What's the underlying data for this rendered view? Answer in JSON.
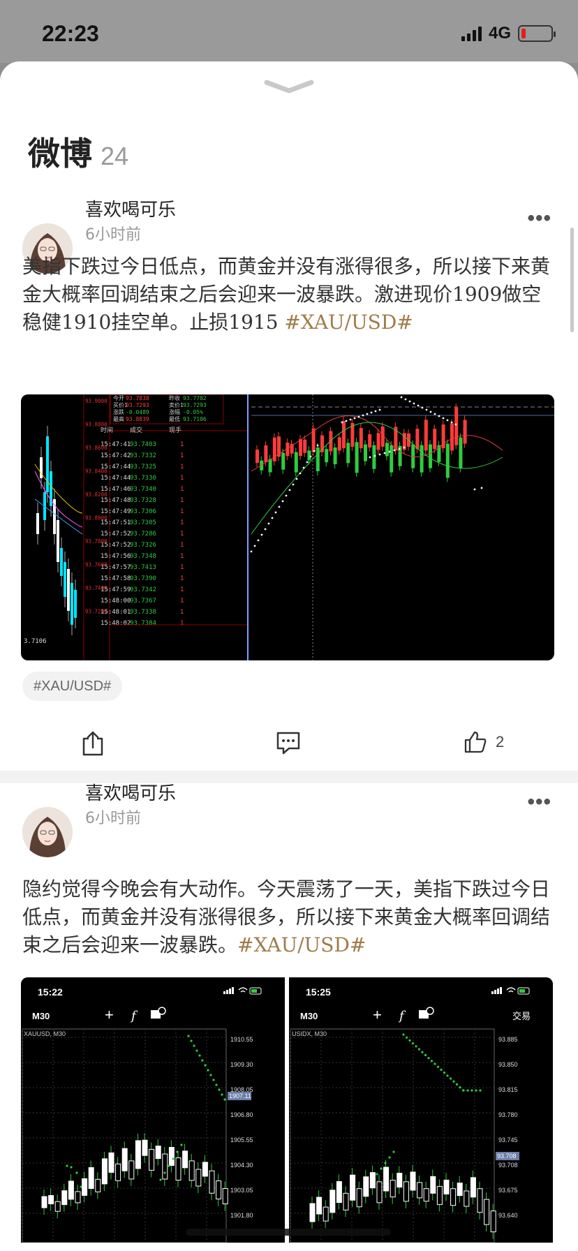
{
  "status_bar": {
    "time": "22:23",
    "network": "4G"
  },
  "header": {
    "title": "微博",
    "count": "24"
  },
  "posts": [
    {
      "author": "喜欢喝可乐",
      "time": "6小时前",
      "text": "美指下跌过今日低点，而黄金并没有涨得很多，所以接下来黄金大概率回调结束之后会迎来一波暴跌。激进现价1909做空稳健1910挂空单。止损1915 ",
      "hashtag": "#XAU/USD#",
      "topic_chip": "#XAU/USD#",
      "likes": "2",
      "image": {
        "left_price_label": "3.7106",
        "quote_rows": [
          {
            "k1": "今开",
            "v1": "93.7838",
            "k2": "昨收",
            "v2": "93.7782"
          },
          {
            "k1": "买价1",
            "v1": "93.7293",
            "k2": "卖价1",
            "v2": "93.7293"
          },
          {
            "k1": "涨跌",
            "v1": "-0.0489",
            "k2": "涨幅",
            "v2": "-0.05%"
          },
          {
            "k1": "最高",
            "v1": "93.8839",
            "k2": "最低",
            "v2": "93.7106"
          }
        ],
        "axis_prices": [
          "93.9000",
          "93.8800",
          "93.8600",
          "93.8400",
          "93.8200",
          "93.8000",
          "93.7800",
          "93.7600",
          "93.7400",
          "93.7200"
        ],
        "ticks_header": {
          "time": "时间",
          "price": "成交",
          "volume": "现手"
        },
        "ticks": [
          {
            "time": "15:47:41",
            "price": "93.7403",
            "vol": "1"
          },
          {
            "time": "15:47:42",
            "price": "93.7332",
            "vol": "1"
          },
          {
            "time": "15:47:44",
            "price": "93.7325",
            "vol": "1"
          },
          {
            "time": "15:47:44",
            "price": "93.7330",
            "vol": "1"
          },
          {
            "time": "15:47:46",
            "price": "93.7340",
            "vol": "1"
          },
          {
            "time": "15:47:48",
            "price": "93.7328",
            "vol": "1"
          },
          {
            "time": "15:47:49",
            "price": "93.7306",
            "vol": "1"
          },
          {
            "time": "15:47:51",
            "price": "93.7305",
            "vol": "1"
          },
          {
            "time": "15:47:52",
            "price": "93.7286",
            "vol": "1"
          },
          {
            "time": "15:47:52",
            "price": "93.7326",
            "vol": "1"
          },
          {
            "time": "15:47:56",
            "price": "93.7348",
            "vol": "1"
          },
          {
            "time": "15:47:57",
            "price": "93.7413",
            "vol": "1"
          },
          {
            "time": "15:47:58",
            "price": "93.7390",
            "vol": "1"
          },
          {
            "time": "15:47:59",
            "price": "93.7342",
            "vol": "1"
          },
          {
            "time": "15:48:00",
            "price": "93.7367",
            "vol": "1"
          },
          {
            "time": "15:48:01",
            "price": "93.7338",
            "vol": "1"
          },
          {
            "time": "15:48:02",
            "price": "93.7384",
            "vol": "1"
          }
        ]
      }
    },
    {
      "author": "喜欢喝可乐",
      "time": "6小时前",
      "text": "隐约觉得今晚会有大动作。今天震荡了一天，美指下跌过今日低点，而黄金并没有涨得很多，所以接下来黄金大概率回调结束之后会迎来一波暴跌。",
      "hashtag": "#XAU/USD#",
      "images": [
        {
          "time": "15:22",
          "timeframe": "M30",
          "symbol": "XAUUSD, M30",
          "trade": "",
          "prices": [
            "1910.55",
            "1909.30",
            "1908.05",
            "1906.80",
            "1905.55",
            "1904.30",
            "1903.05",
            "1901.80"
          ],
          "current": "1907.11"
        },
        {
          "time": "15:25",
          "timeframe": "M30",
          "symbol": "USIDX, M30",
          "trade": "交易",
          "prices": [
            "93.885",
            "93.850",
            "93.815",
            "93.780",
            "93.745",
            "93.708",
            "93.675",
            "93.640"
          ],
          "current": "93.708"
        }
      ]
    }
  ],
  "colors": {
    "tag": "#a07b4a",
    "up": "#ff3b3b",
    "down": "#00d0d0",
    "green": "#2ecc40"
  }
}
